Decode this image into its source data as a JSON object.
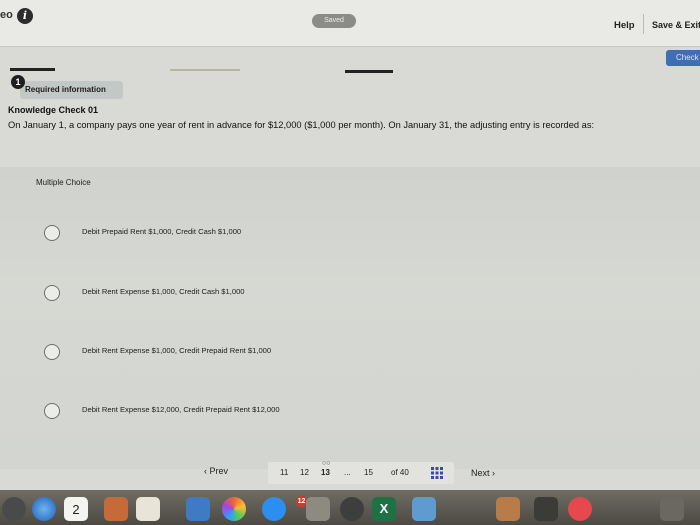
{
  "header": {
    "brand": "eo",
    "saved_label": "Saved",
    "help_label": "Help",
    "save_exit_label": "Save & Exit",
    "check_label": "Check"
  },
  "question": {
    "step_number": "1",
    "required_label": "Required information",
    "title": "Knowledge Check 01",
    "text": "On January 1, a company pays one year of rent in advance for $12,000 ($1,000 per month). On January 31, the adjusting entry is recorded as:"
  },
  "answers": {
    "type_label": "Multiple Choice",
    "options": [
      "Debit Prepaid Rent $1,000, Credit Cash $1,000",
      "Debit Rent Expense $1,000, Credit Cash $1,000",
      "Debit Rent Expense $1,000, Credit Prepaid Rent $1,000",
      "Debit Rent Expense $12,000, Credit Prepaid Rent $12,000"
    ]
  },
  "pagination": {
    "prev_label": "Prev",
    "pages": [
      "11",
      "12",
      "13",
      "...",
      "15"
    ],
    "current_page": "13",
    "total_label": "of 40",
    "next_label": "Next",
    "grid_icon": "grid-icon"
  },
  "dock": {
    "calendar_date": "2",
    "mail_badge": "12"
  }
}
